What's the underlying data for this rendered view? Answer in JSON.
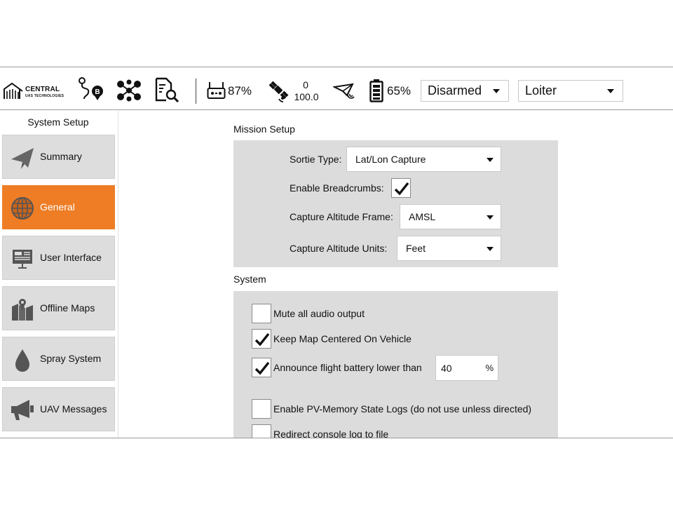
{
  "toolbar": {
    "logo": {
      "name": "CENTRAL",
      "subtitle": "UAS TECHNOLOGIES"
    },
    "rc_signal_percent": "87%",
    "gps": {
      "satellites": "0",
      "hdop": "100.0"
    },
    "battery_percent": "65%",
    "arm_state": "Disarmed",
    "flight_mode": "Loiter"
  },
  "sidebar": {
    "title": "System Setup",
    "items": [
      {
        "label": "Summary",
        "icon": "paper-plane-icon",
        "active": false
      },
      {
        "label": "General",
        "icon": "globe-icon",
        "active": true
      },
      {
        "label": "User Interface",
        "icon": "monitor-icon",
        "active": false
      },
      {
        "label": "Offline Maps",
        "icon": "map-icon",
        "active": false
      },
      {
        "label": "Spray System",
        "icon": "droplet-icon",
        "active": false
      },
      {
        "label": "UAV Messages",
        "icon": "megaphone-icon",
        "active": false
      }
    ]
  },
  "mission_setup": {
    "title": "Mission Setup",
    "sortie_type": {
      "label": "Sortie Type:",
      "value": "Lat/Lon Capture"
    },
    "breadcrumbs": {
      "label": "Enable Breadcrumbs:",
      "checked": true
    },
    "altitude_frame": {
      "label": "Capture Altitude Frame:",
      "value": "AMSL"
    },
    "altitude_units": {
      "label": "Capture Altitude Units:",
      "value": "Feet"
    }
  },
  "system": {
    "title": "System",
    "mute_audio": {
      "label": "Mute all audio output",
      "checked": false
    },
    "keep_map_centered": {
      "label": "Keep Map Centered On Vehicle",
      "checked": true
    },
    "announce_battery": {
      "label": "Announce flight battery lower than",
      "checked": true,
      "value": "40",
      "unit": "%"
    },
    "pv_memory_logs": {
      "label": "Enable PV-Memory State Logs (do not use unless directed)",
      "checked": false
    },
    "redirect_console": {
      "label": "Redirect console log to file",
      "checked": false
    }
  },
  "colors": {
    "accent": "#ee7d25",
    "panel": "#dcdcdc",
    "sidebar_item": "#dddddd"
  }
}
